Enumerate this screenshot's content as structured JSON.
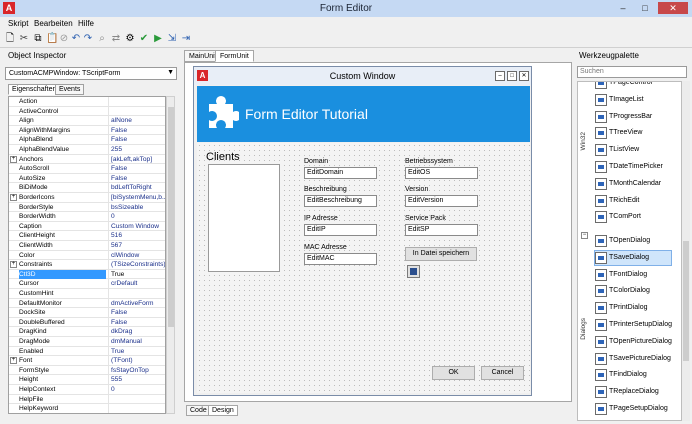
{
  "window": {
    "title": "Form Editor",
    "app_icon": "A",
    "minimize": "–",
    "maximize": "□",
    "close": "✕"
  },
  "menu": [
    "Skript",
    "Bearbeiten",
    "Hilfe"
  ],
  "object_inspector": {
    "title": "Object Inspector",
    "combo_value": "CustomACMPWindow: TScriptForm",
    "tabs": [
      "Eigenschaften",
      "Events"
    ],
    "properties": [
      {
        "name": "Action",
        "value": ""
      },
      {
        "name": "ActiveControl",
        "value": ""
      },
      {
        "name": "Align",
        "value": "alNone"
      },
      {
        "name": "AlignWithMargins",
        "value": "False"
      },
      {
        "name": "AlphaBlend",
        "value": "False"
      },
      {
        "name": "AlphaBlendValue",
        "value": "255"
      },
      {
        "name": "Anchors",
        "value": "[akLeft,akTop]",
        "expander": "+"
      },
      {
        "name": "AutoScroll",
        "value": "False"
      },
      {
        "name": "AutoSize",
        "value": "False"
      },
      {
        "name": "BiDiMode",
        "value": "bdLeftToRight"
      },
      {
        "name": "BorderIcons",
        "value": "[biSystemMenu,b...",
        "expander": "+"
      },
      {
        "name": "BorderStyle",
        "value": "bsSizeable"
      },
      {
        "name": "BorderWidth",
        "value": "0"
      },
      {
        "name": "Caption",
        "value": "Custom Window"
      },
      {
        "name": "ClientHeight",
        "value": "516"
      },
      {
        "name": "ClientWidth",
        "value": "567"
      },
      {
        "name": "Color",
        "value": "clWindow"
      },
      {
        "name": "Constraints",
        "value": "(TSizeConstraints)",
        "expander": "+"
      },
      {
        "name": "Ctl3D",
        "value": "True",
        "selected": true
      },
      {
        "name": "Cursor",
        "value": "crDefault"
      },
      {
        "name": "CustomHint",
        "value": ""
      },
      {
        "name": "DefaultMonitor",
        "value": "dmActiveForm"
      },
      {
        "name": "DockSite",
        "value": "False"
      },
      {
        "name": "DoubleBuffered",
        "value": "False"
      },
      {
        "name": "DragKind",
        "value": "dkDrag"
      },
      {
        "name": "DragMode",
        "value": "dmManual"
      },
      {
        "name": "Enabled",
        "value": "True"
      },
      {
        "name": "Font",
        "value": "(TFont)",
        "expander": "+"
      },
      {
        "name": "FormStyle",
        "value": "fsStayOnTop"
      },
      {
        "name": "Height",
        "value": "555"
      },
      {
        "name": "HelpContext",
        "value": "0"
      },
      {
        "name": "HelpFile",
        "value": ""
      },
      {
        "name": "HelpKeyword",
        "value": ""
      }
    ]
  },
  "editor": {
    "tabs": [
      "MainUnit",
      "FormUnit"
    ],
    "bottom_tabs": [
      "Code",
      "Design"
    ]
  },
  "custom_window": {
    "title": "Custom Window",
    "icon": "A",
    "banner_text": "Form Editor Tutorial",
    "clients_label": "Clients",
    "fields": [
      {
        "label": "Domain",
        "value": "EditDomain"
      },
      {
        "label": "Betriebssystem",
        "value": "EditOS"
      },
      {
        "label": "Beschreibung",
        "value": "EditBeschreibung"
      },
      {
        "label": "Version",
        "value": "EditVersion"
      },
      {
        "label": "IP Adresse",
        "value": "EditIP"
      },
      {
        "label": "Service Pack",
        "value": "EditSP"
      },
      {
        "label": "MAC Adresse",
        "value": "EditMAC"
      }
    ],
    "save_button": "In Datei speichern",
    "ok_button": "OK",
    "cancel_button": "Cancel"
  },
  "palette": {
    "title": "Werkzeugpalette",
    "search_placeholder": "Suchen",
    "categories": [
      "Win32",
      "Dialogs"
    ],
    "win32_items": [
      "TPageControl",
      "TImageList",
      "TProgressBar",
      "TTreeView",
      "TListView",
      "TDateTimePicker",
      "TMonthCalendar",
      "TRichEdit",
      "TComPort"
    ],
    "dialog_items": [
      "TOpenDialog",
      "TSaveDialog",
      "TFontDialog",
      "TColorDialog",
      "TPrintDialog",
      "TPrinterSetupDialog",
      "TOpenPictureDialog",
      "TSavePictureDialog",
      "TFindDialog",
      "TReplaceDialog",
      "TPageSetupDialog"
    ]
  },
  "colors": {
    "accent": "#1a8fdf",
    "selection": "#3399ff",
    "titlebar": "#c5d9f3"
  }
}
